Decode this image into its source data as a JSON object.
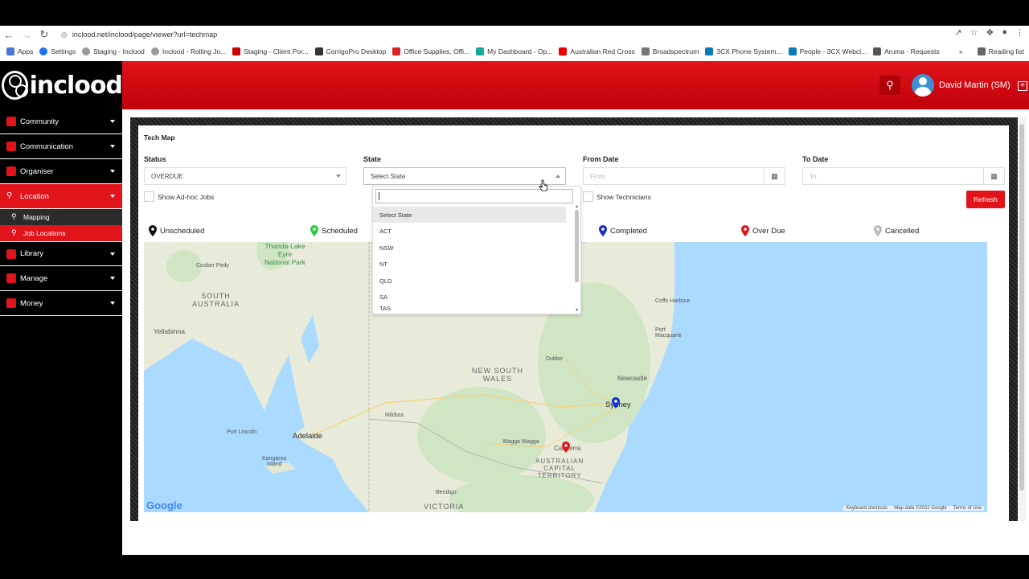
{
  "browser": {
    "url": "inclood.net/inclood/page/viewer?url=techmap",
    "bookmarks": [
      "Apps",
      "Settings",
      "Staging - Inclood",
      "Inclood - Rolling Jo...",
      "Staging - Client Por...",
      "CorrigoPro Desktop",
      "Office Supplies, Offi...",
      "My Dashboard - Op...",
      "Australian Red Cross",
      "Broadspectrum",
      "3CX Phone System...",
      "People - 3CX Webcl...",
      "Aruma - Requests"
    ],
    "reading_list": "Reading list"
  },
  "header": {
    "logo_text": "inclood",
    "user_name": "David Martin (SM)",
    "brand_color": "#e1141b"
  },
  "sidebar": {
    "items": [
      {
        "label": "Community"
      },
      {
        "label": "Communication"
      },
      {
        "label": "Organiser"
      },
      {
        "label": "Location"
      },
      {
        "label": "Library"
      },
      {
        "label": "Manage"
      },
      {
        "label": "Money"
      }
    ],
    "location_sub": [
      "Mapping",
      "Job Locations"
    ]
  },
  "panel": {
    "title": "Tech Map",
    "status_label": "Status",
    "status_value": "OVERDUE",
    "state_label": "State",
    "state_value": "Select State",
    "from_label": "From Date",
    "from_placeholder": "From",
    "to_label": "To Date",
    "to_placeholder": "To",
    "adhoc_label": "Show Ad-hoc Jobs",
    "technicians_label": "Show Technicians",
    "refresh_label": "Refresh"
  },
  "dropdown": {
    "options": [
      "Select State",
      "ACT",
      "NSW",
      "NT",
      "QLD",
      "SA",
      "TAS"
    ]
  },
  "legend": [
    {
      "label": "Unscheduled",
      "color": "#111111"
    },
    {
      "label": "Scheduled",
      "color": "#2ecc40"
    },
    {
      "label": "Completed",
      "color": "#1a2fd0"
    },
    {
      "label": "Over Due",
      "color": "#e1141b"
    },
    {
      "label": "Cancelled",
      "color": "#bbbbbb"
    }
  ],
  "map": {
    "labels": {
      "south_australia": "SOUTH\nAUSTRALIA",
      "new_south_wales": "NEW SOUTH\nWALES",
      "act": "AUSTRALIAN\nCAPITAL\nTERRITORY",
      "victoria": "VICTORIA",
      "thanda": "Thanda-Lake\nEyre\nNational Park",
      "coober_pedy": "Coober Pedy",
      "yellabinna": "Yellabinna",
      "port_lincoln": "Port Lincoln",
      "adelaide": "Adelaide",
      "kangaroo_island": "Kangaroo\nIsland",
      "mildura": "Mildura",
      "wagga": "Wagga Wagga",
      "canberra": "Canberra",
      "bendigo": "Bendigo",
      "dubbo": "Dubbo",
      "newcastle": "Newcastle",
      "sydney": "Sydney",
      "coffs": "Coffs Harbour",
      "port_macquarie": "Port\nMacquarie"
    },
    "google": "Google",
    "keyboard": "Keyboard shortcuts",
    "mapdata": "Map data ©2022 Google",
    "terms": "Terms of Use"
  }
}
